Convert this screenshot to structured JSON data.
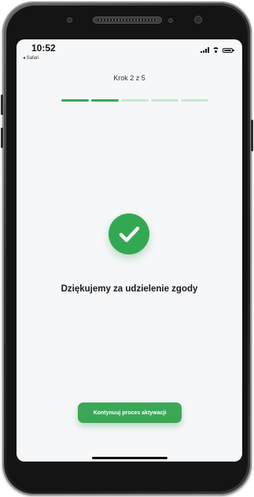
{
  "status_bar": {
    "time": "10:52",
    "back_app": "◂ Safari"
  },
  "wizard": {
    "step_label": "Krok 2 z 5",
    "current_step": 2,
    "total_steps": 5
  },
  "message": "Dziękujemy za udzielenie zgody",
  "continue_button": {
    "label": "Kontynuuj proces aktywacji"
  },
  "icons": {
    "success": "checkmark-icon",
    "signal": "signal-icon",
    "wifi": "wifi-icon",
    "battery": "battery-icon"
  },
  "colors": {
    "accent": "#3aa757",
    "progress_inactive": "#c8e6cd",
    "screen_background": "#f6f7f9"
  }
}
